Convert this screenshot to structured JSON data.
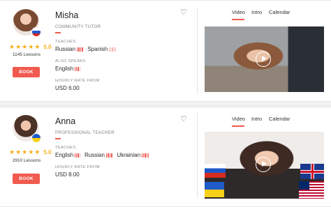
{
  "tutors": [
    {
      "name": "Misha",
      "title": "COMMUNITY TUTOR",
      "teaches_label": "TEACHES",
      "teaches": [
        "Russian",
        "Spanish"
      ],
      "also_speaks_label": "ALSO SPEAKS",
      "also_speaks": [
        "English"
      ],
      "rate_label": "HOURLY RATE FROM",
      "rate": "USD 6.00",
      "rating": "5.0",
      "lessons": "1145 Lessons",
      "book_label": "BOOK",
      "flag": "russia-flag",
      "tabs": [
        "Video",
        "Intro",
        "Calendar"
      ],
      "active_tab": "Video"
    },
    {
      "name": "Anna",
      "title": "PROFESSIONAL TEACHER",
      "teaches_label": "TEACHES",
      "teaches": [
        "English",
        "Russian",
        "Ukrainian"
      ],
      "rate_label": "HOURLY RATE FROM",
      "rate": "USD 8.00",
      "rating": "5.0",
      "lessons": "2910 Lessons",
      "book_label": "BOOK",
      "flag": "ukraine-flag",
      "tabs": [
        "Video",
        "Intro",
        "Calendar"
      ],
      "active_tab": "Video"
    }
  ],
  "icons": {
    "favorite": "heart-icon",
    "star": "star-icon",
    "play": "play-icon"
  },
  "colors": {
    "accent": "#f05a4f",
    "star": "#f2b11b",
    "background": "#f1f1f3"
  }
}
